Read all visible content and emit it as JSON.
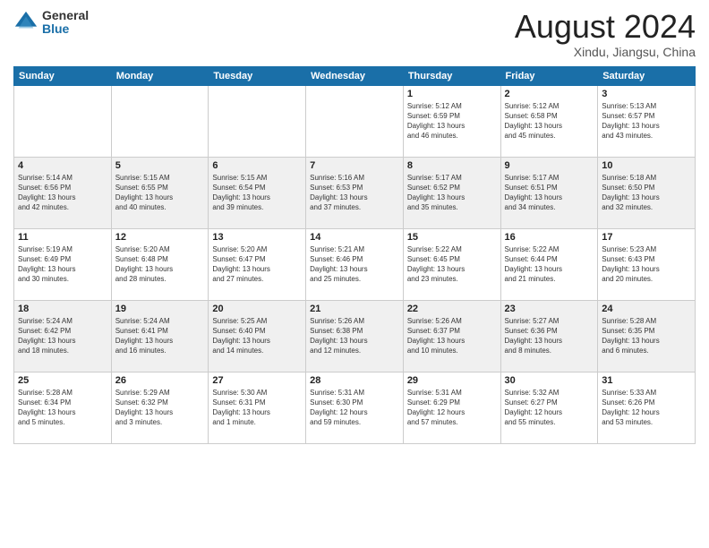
{
  "logo": {
    "general": "General",
    "blue": "Blue"
  },
  "title": "August 2024",
  "location": "Xindu, Jiangsu, China",
  "weekdays": [
    "Sunday",
    "Monday",
    "Tuesday",
    "Wednesday",
    "Thursday",
    "Friday",
    "Saturday"
  ],
  "weeks": [
    [
      {
        "day": "",
        "info": ""
      },
      {
        "day": "",
        "info": ""
      },
      {
        "day": "",
        "info": ""
      },
      {
        "day": "",
        "info": ""
      },
      {
        "day": "1",
        "info": "Sunrise: 5:12 AM\nSunset: 6:59 PM\nDaylight: 13 hours\nand 46 minutes."
      },
      {
        "day": "2",
        "info": "Sunrise: 5:12 AM\nSunset: 6:58 PM\nDaylight: 13 hours\nand 45 minutes."
      },
      {
        "day": "3",
        "info": "Sunrise: 5:13 AM\nSunset: 6:57 PM\nDaylight: 13 hours\nand 43 minutes."
      }
    ],
    [
      {
        "day": "4",
        "info": "Sunrise: 5:14 AM\nSunset: 6:56 PM\nDaylight: 13 hours\nand 42 minutes."
      },
      {
        "day": "5",
        "info": "Sunrise: 5:15 AM\nSunset: 6:55 PM\nDaylight: 13 hours\nand 40 minutes."
      },
      {
        "day": "6",
        "info": "Sunrise: 5:15 AM\nSunset: 6:54 PM\nDaylight: 13 hours\nand 39 minutes."
      },
      {
        "day": "7",
        "info": "Sunrise: 5:16 AM\nSunset: 6:53 PM\nDaylight: 13 hours\nand 37 minutes."
      },
      {
        "day": "8",
        "info": "Sunrise: 5:17 AM\nSunset: 6:52 PM\nDaylight: 13 hours\nand 35 minutes."
      },
      {
        "day": "9",
        "info": "Sunrise: 5:17 AM\nSunset: 6:51 PM\nDaylight: 13 hours\nand 34 minutes."
      },
      {
        "day": "10",
        "info": "Sunrise: 5:18 AM\nSunset: 6:50 PM\nDaylight: 13 hours\nand 32 minutes."
      }
    ],
    [
      {
        "day": "11",
        "info": "Sunrise: 5:19 AM\nSunset: 6:49 PM\nDaylight: 13 hours\nand 30 minutes."
      },
      {
        "day": "12",
        "info": "Sunrise: 5:20 AM\nSunset: 6:48 PM\nDaylight: 13 hours\nand 28 minutes."
      },
      {
        "day": "13",
        "info": "Sunrise: 5:20 AM\nSunset: 6:47 PM\nDaylight: 13 hours\nand 27 minutes."
      },
      {
        "day": "14",
        "info": "Sunrise: 5:21 AM\nSunset: 6:46 PM\nDaylight: 13 hours\nand 25 minutes."
      },
      {
        "day": "15",
        "info": "Sunrise: 5:22 AM\nSunset: 6:45 PM\nDaylight: 13 hours\nand 23 minutes."
      },
      {
        "day": "16",
        "info": "Sunrise: 5:22 AM\nSunset: 6:44 PM\nDaylight: 13 hours\nand 21 minutes."
      },
      {
        "day": "17",
        "info": "Sunrise: 5:23 AM\nSunset: 6:43 PM\nDaylight: 13 hours\nand 20 minutes."
      }
    ],
    [
      {
        "day": "18",
        "info": "Sunrise: 5:24 AM\nSunset: 6:42 PM\nDaylight: 13 hours\nand 18 minutes."
      },
      {
        "day": "19",
        "info": "Sunrise: 5:24 AM\nSunset: 6:41 PM\nDaylight: 13 hours\nand 16 minutes."
      },
      {
        "day": "20",
        "info": "Sunrise: 5:25 AM\nSunset: 6:40 PM\nDaylight: 13 hours\nand 14 minutes."
      },
      {
        "day": "21",
        "info": "Sunrise: 5:26 AM\nSunset: 6:38 PM\nDaylight: 13 hours\nand 12 minutes."
      },
      {
        "day": "22",
        "info": "Sunrise: 5:26 AM\nSunset: 6:37 PM\nDaylight: 13 hours\nand 10 minutes."
      },
      {
        "day": "23",
        "info": "Sunrise: 5:27 AM\nSunset: 6:36 PM\nDaylight: 13 hours\nand 8 minutes."
      },
      {
        "day": "24",
        "info": "Sunrise: 5:28 AM\nSunset: 6:35 PM\nDaylight: 13 hours\nand 6 minutes."
      }
    ],
    [
      {
        "day": "25",
        "info": "Sunrise: 5:28 AM\nSunset: 6:34 PM\nDaylight: 13 hours\nand 5 minutes."
      },
      {
        "day": "26",
        "info": "Sunrise: 5:29 AM\nSunset: 6:32 PM\nDaylight: 13 hours\nand 3 minutes."
      },
      {
        "day": "27",
        "info": "Sunrise: 5:30 AM\nSunset: 6:31 PM\nDaylight: 13 hours\nand 1 minute."
      },
      {
        "day": "28",
        "info": "Sunrise: 5:31 AM\nSunset: 6:30 PM\nDaylight: 12 hours\nand 59 minutes."
      },
      {
        "day": "29",
        "info": "Sunrise: 5:31 AM\nSunset: 6:29 PM\nDaylight: 12 hours\nand 57 minutes."
      },
      {
        "day": "30",
        "info": "Sunrise: 5:32 AM\nSunset: 6:27 PM\nDaylight: 12 hours\nand 55 minutes."
      },
      {
        "day": "31",
        "info": "Sunrise: 5:33 AM\nSunset: 6:26 PM\nDaylight: 12 hours\nand 53 minutes."
      }
    ]
  ]
}
